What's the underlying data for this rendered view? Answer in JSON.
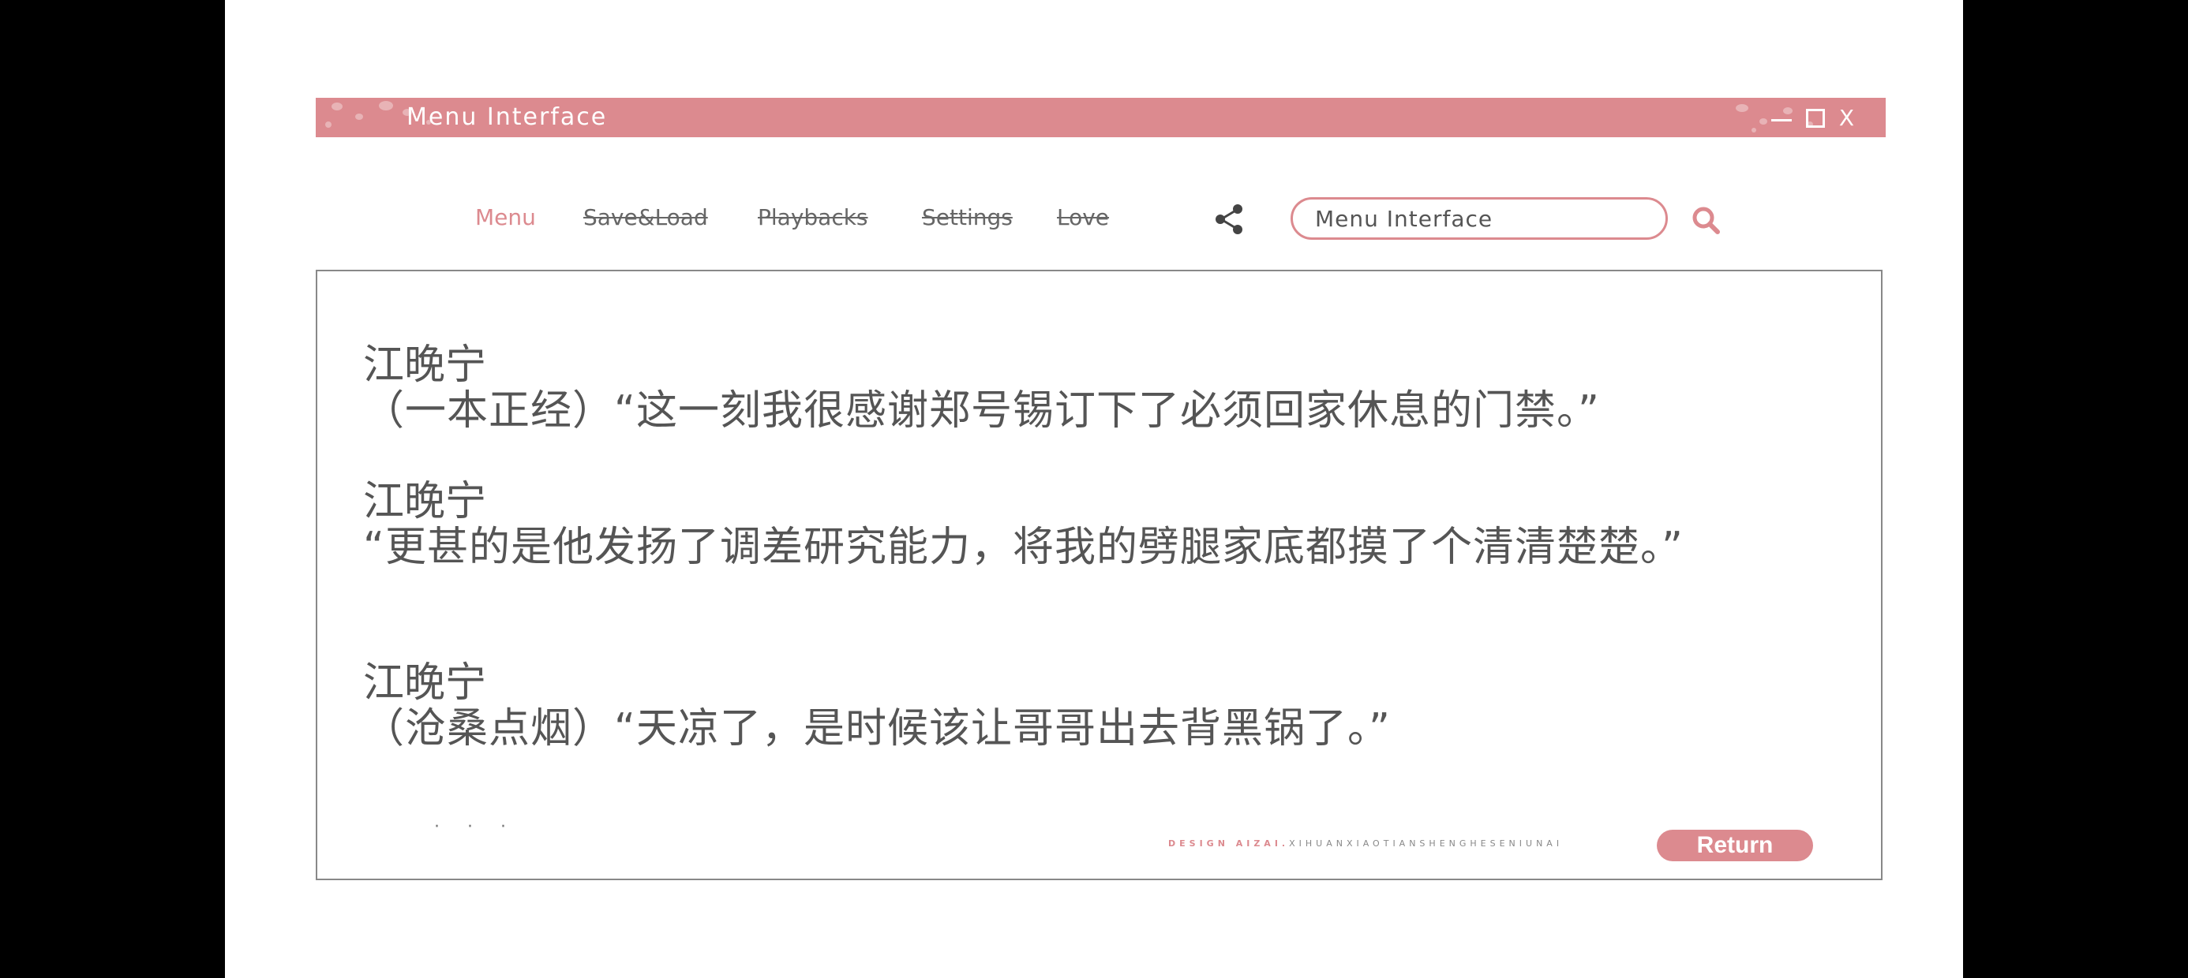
{
  "window": {
    "title": "Menu Interface",
    "controls": {
      "minimize": "—",
      "maximize": "□",
      "close": "X"
    }
  },
  "nav": {
    "items": [
      {
        "label": "Menu",
        "active": true
      },
      {
        "label": "Save&Load",
        "active": false
      },
      {
        "label": "Playbacks",
        "active": false
      },
      {
        "label": "Settings",
        "active": false
      },
      {
        "label": "Love",
        "active": false
      }
    ]
  },
  "search": {
    "value": "Menu Interface"
  },
  "dialogue": [
    {
      "speaker": "江晚宁",
      "text": "（一本正经）“这一刻我很感谢郑号锡订下了必须回家休息的门禁。”"
    },
    {
      "speaker": "江晚宁",
      "text": "“更甚的是他发扬了调差研究能力，将我的劈腿家底都摸了个清清楚楚。”"
    },
    {
      "speaker": "江晚宁",
      "text": "（沧桑点烟）“天凉了，是时候该让哥哥出去背黑锅了。”"
    }
  ],
  "footer": {
    "ellipsis": "· · ·",
    "design_prefix": "DESIGN AIZAI.",
    "design_suffix": "XIHUANXIAOTIANSHENGHESENIUNAI",
    "return_label": "Return"
  },
  "colors": {
    "accent": "#dc8a8f",
    "text": "#555555",
    "nav_text": "#666666"
  }
}
